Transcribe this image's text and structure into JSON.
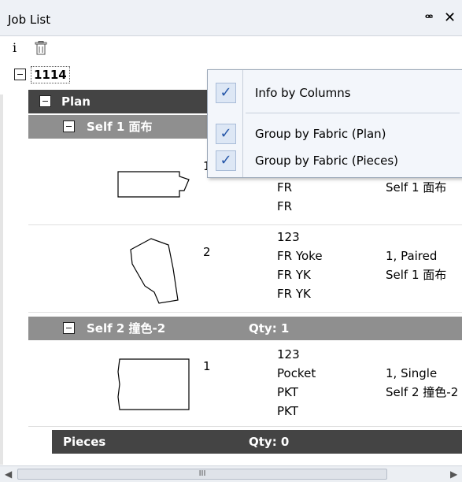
{
  "panel": {
    "title": "Job List",
    "pin_icon": "pin-icon",
    "close_icon": "close-icon"
  },
  "toolbar": {
    "info_glyph": "i",
    "info_icon": "info-icon",
    "delete_icon": "trash-icon"
  },
  "tree": {
    "job": "1114",
    "plan_label": "Plan",
    "group1": "Self 1 面布",
    "group2": "Self 2 撞色-2",
    "group2_qty": "Qty: 1",
    "pieces_label": "Pieces",
    "pieces_qty": "Qty: 0",
    "pieces_g1": [
      {
        "num": "1",
        "col1": [
          "",
          "FR",
          "FR"
        ],
        "col2": [
          "",
          "Self 1 面布"
        ]
      },
      {
        "num": "2",
        "col1": [
          "123",
          "FR Yoke",
          "FR YK",
          "FR YK"
        ],
        "col2": [
          "",
          "1, Paired",
          "Self 1 面布"
        ]
      }
    ],
    "pieces_g2": [
      {
        "num": "1",
        "col1": [
          "123",
          "Pocket",
          "PKT",
          "PKT"
        ],
        "col2": [
          "",
          "1, Single",
          "Self 2 撞色-2"
        ]
      }
    ]
  },
  "context_menu": {
    "items": [
      {
        "label": "Info by Columns",
        "checked": true
      },
      {
        "label": "Group by Fabric (Plan)",
        "checked": true
      },
      {
        "label": "Group by Fabric (Pieces)",
        "checked": true
      }
    ]
  },
  "scrollbar": {
    "grip": "III"
  },
  "colors": {
    "dark_bar": "#444444",
    "mid_bar": "#8f8f8f",
    "menu_bg": "#f3f6fb",
    "check": "#2556a8"
  }
}
